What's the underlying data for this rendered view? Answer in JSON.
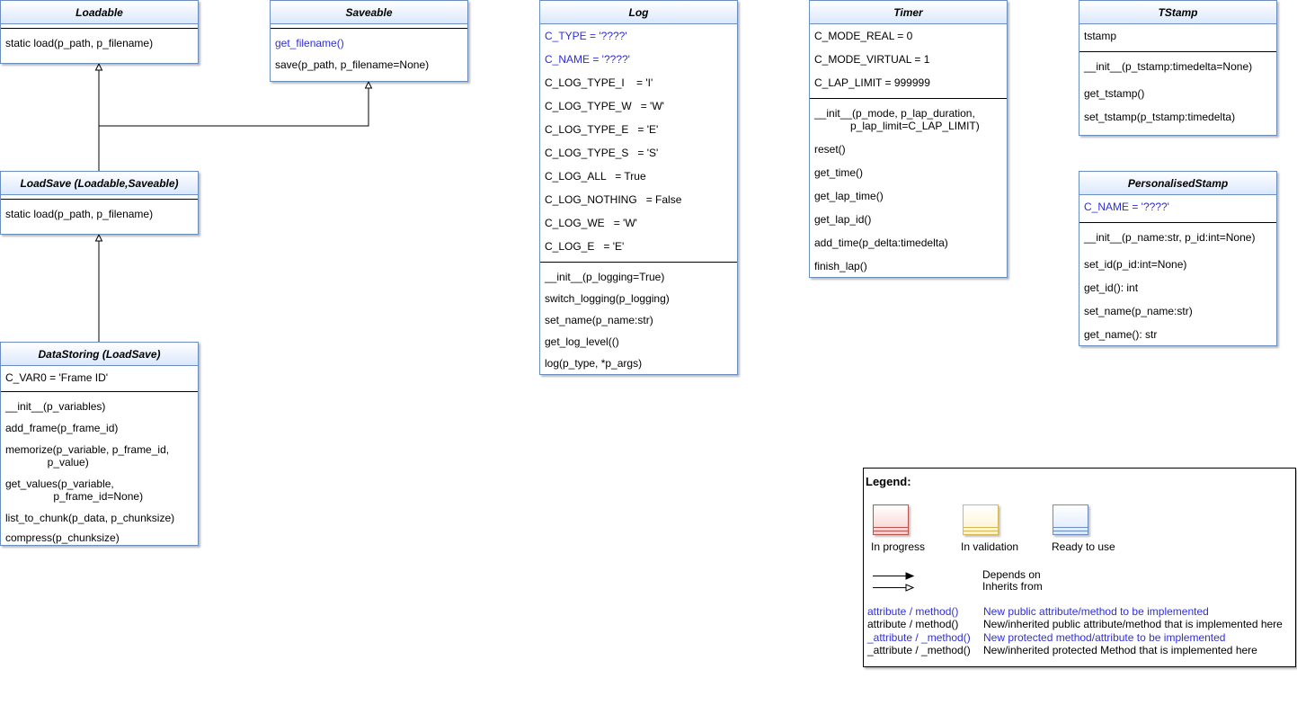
{
  "classes": {
    "loadable": {
      "name": "Loadable",
      "methods": [
        "static load(p_path, p_filename)"
      ]
    },
    "saveable": {
      "name": "Saveable",
      "methods": [
        "get_filename()",
        "save(p_path, p_filename=None)"
      ]
    },
    "loadsave": {
      "name": "LoadSave (Loadable,Saveable)",
      "methods": [
        "static load(p_path, p_filename)"
      ]
    },
    "datastoring": {
      "name": "DataStoring (LoadSave)",
      "attributes": [
        "C_VAR0 = 'Frame ID'"
      ],
      "methods": [
        "__init__(p_variables)",
        "add_frame(p_frame_id)",
        "memorize(p_variable, p_frame_id,\n              p_value)",
        "get_values(p_variable,\n                p_frame_id=None)",
        "list_to_chunk(p_data, p_chunksize)",
        "compress(p_chunksize)"
      ]
    },
    "log": {
      "name": "Log",
      "attributes": [
        "C_TYPE = '????'",
        "C_NAME = '????'",
        "C_LOG_TYPE_I    = 'I'",
        "C_LOG_TYPE_W   = 'W'",
        "C_LOG_TYPE_E   = 'E'",
        "C_LOG_TYPE_S   = 'S'",
        "C_LOG_ALL   = True",
        "C_LOG_NOTHING   = False",
        "C_LOG_WE   = 'W'",
        "C_LOG_E   = 'E'"
      ],
      "methods": [
        "__init__(p_logging=True)",
        "switch_logging(p_logging)",
        "set_name(p_name:str)",
        "get_log_level(()",
        "log(p_type, *p_args)"
      ]
    },
    "timer": {
      "name": "Timer",
      "attributes": [
        "C_MODE_REAL = 0",
        "C_MODE_VIRTUAL = 1",
        "C_LAP_LIMIT = 999999"
      ],
      "methods": [
        "__init__(p_mode, p_lap_duration,\n            p_lap_limit=C_LAP_LIMIT)",
        "reset()",
        "get_time()",
        "get_lap_time()",
        "get_lap_id()",
        "add_time(p_delta:timedelta)",
        "finish_lap()"
      ]
    },
    "tstamp": {
      "name": "TStamp",
      "attributes": [
        "tstamp"
      ],
      "methods": [
        "__init__(p_tstamp:timedelta=None)",
        "get_tstamp()",
        "set_tstamp(p_tstamp:timedelta)"
      ]
    },
    "personalisedstamp": {
      "name": "PersonalisedStamp",
      "attributes": [
        "C_NAME = '????'"
      ],
      "methods": [
        "__init__(p_name:str, p_id:int=None)",
        "set_id(p_id:int=None)",
        "get_id(): int",
        "set_name(p_name:str)",
        "get_name(): str"
      ]
    }
  },
  "legend": {
    "title": "Legend:",
    "states": [
      "In progress",
      "In validation",
      "Ready to use"
    ],
    "arrows": [
      "Depends on",
      "Inherits from"
    ],
    "notation": [
      {
        "symbol": "attribute / method()",
        "meaning": "New public attribute/method to be implemented"
      },
      {
        "symbol": "attribute / method()",
        "meaning": "New/inherited public attribute/method that is implemented here"
      },
      {
        "symbol": "_attribute / _method()",
        "meaning": "New protected method/attribute to be implemented"
      },
      {
        "symbol": "_attribute / _method()",
        "meaning": "New/inherited protected Method that is implemented here"
      }
    ]
  },
  "colors": {
    "new_member": "#2e2ed8",
    "ready_border": "#6c8ebf",
    "ready_fill": "#dae8fc",
    "progress_border": "#b85450",
    "progress_fill": "#f8cecc",
    "validation_border": "#d6b656",
    "validation_fill": "#fff2cc"
  }
}
